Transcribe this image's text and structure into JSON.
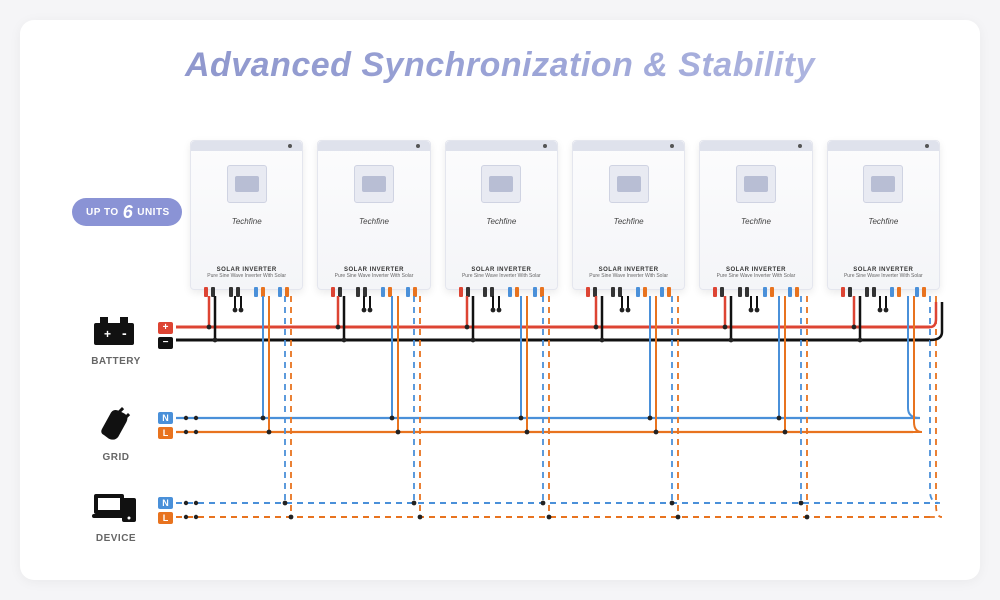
{
  "title": "Advanced Synchronization & Stability",
  "badge": {
    "prefix": "UP TO",
    "count": "6",
    "suffix": "UNITS"
  },
  "unit_count": 6,
  "inverter": {
    "brand": "Techfine",
    "model_line1": "SOLAR INVERTER",
    "model_line2": "Pure Sine Wave Inverter With Solar"
  },
  "labels": {
    "battery": "BATTERY",
    "grid": "GRID",
    "device": "DEVICE",
    "neutral": "N",
    "live": "L",
    "plus": "+",
    "minus": "−"
  },
  "connections": {
    "battery": {
      "polarity": [
        "+",
        "-"
      ],
      "wire_colors": [
        "red",
        "black"
      ],
      "style": "solid"
    },
    "grid": {
      "terminals": [
        "N",
        "L"
      ],
      "wire_colors": [
        "blue",
        "orange"
      ],
      "style": "solid"
    },
    "device": {
      "terminals": [
        "N",
        "L"
      ],
      "wire_colors": [
        "blue",
        "orange"
      ],
      "style": "dashed"
    }
  },
  "colors": {
    "accent": "#8a93d5",
    "red": "#d43",
    "black": "#111",
    "blue": "#4a90d9",
    "orange": "#e8731f"
  }
}
